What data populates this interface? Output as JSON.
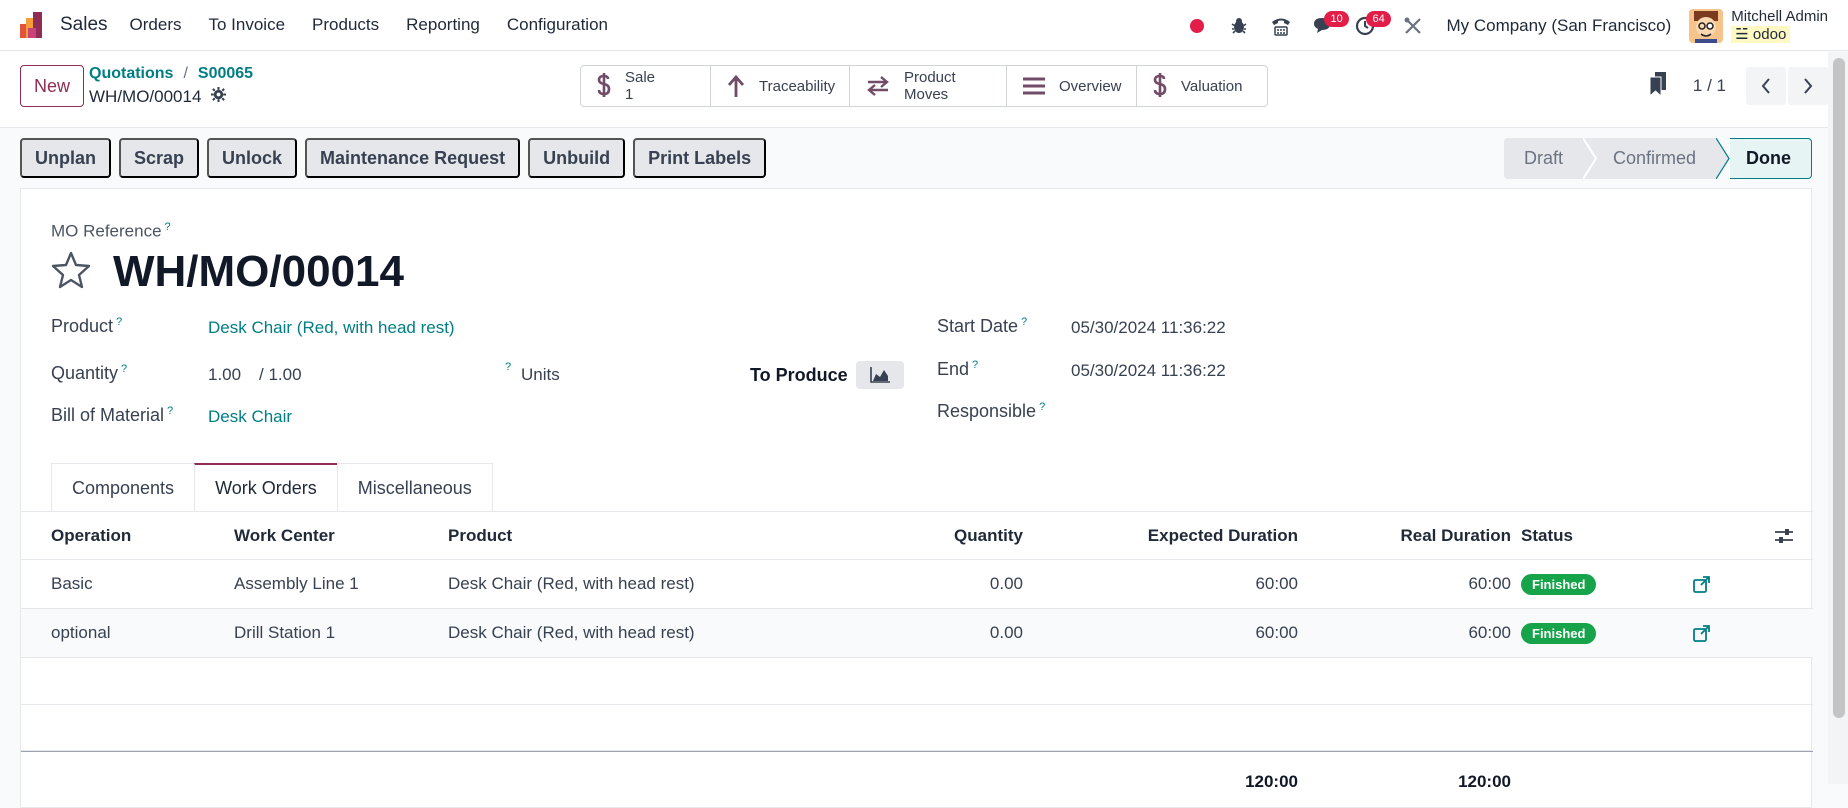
{
  "navbar": {
    "app_name": "Sales",
    "menu": [
      "Orders",
      "To Invoice",
      "Products",
      "Reporting",
      "Configuration"
    ],
    "badges": {
      "messages": "10",
      "activities": "64"
    },
    "company": "My Company (San Francisco)",
    "user_name": "Mitchell Admin",
    "database": "odoo"
  },
  "control": {
    "new_label": "New",
    "breadcrumb": [
      "Quotations",
      "S00065"
    ],
    "record_name": "WH/MO/00014",
    "smart_buttons": {
      "sale_label": "Sale",
      "sale_count": "1",
      "traceability": "Traceability",
      "product_moves": "Product Moves",
      "overview": "Overview",
      "valuation": "Valuation"
    },
    "pager": "1 / 1"
  },
  "actions": [
    "Unplan",
    "Scrap",
    "Unlock",
    "Maintenance Request",
    "Unbuild",
    "Print Labels"
  ],
  "stages": [
    "Draft",
    "Confirmed",
    "Done"
  ],
  "form": {
    "mo_reference_label": "MO Reference",
    "title": "WH/MO/00014",
    "product_label": "Product",
    "product_value": "Desk Chair (Red, with head rest)",
    "quantity_label": "Quantity",
    "quantity_value": "1.00",
    "quantity_total": "/ 1.00",
    "uom": "Units",
    "to_produce": "To Produce",
    "bom_label": "Bill of Material",
    "bom_value": "Desk Chair",
    "start_label": "Start Date",
    "start_value": "05/30/2024 11:36:22",
    "end_label": "End",
    "end_value": "05/30/2024 11:36:22",
    "responsible_label": "Responsible"
  },
  "tabs": [
    "Components",
    "Work Orders",
    "Miscellaneous"
  ],
  "table": {
    "headers": [
      "Operation",
      "Work Center",
      "Product",
      "Quantity",
      "Expected Duration",
      "Real Duration",
      "Status"
    ],
    "rows": [
      {
        "operation": "Basic",
        "work_center": "Assembly Line 1",
        "product": "Desk Chair (Red, with head rest)",
        "quantity": "0.00",
        "expected": "60:00",
        "real": "60:00",
        "status": "Finished"
      },
      {
        "operation": "optional",
        "work_center": "Drill Station 1",
        "product": "Desk Chair (Red, with head rest)",
        "quantity": "0.00",
        "expected": "60:00",
        "real": "60:00",
        "status": "Finished"
      }
    ],
    "totals": {
      "expected": "120:00",
      "real": "120:00"
    }
  },
  "colors": {
    "brand": "#8f2d56",
    "link": "#017e84",
    "finished": "#16a34a",
    "badge": "#e11d48"
  }
}
